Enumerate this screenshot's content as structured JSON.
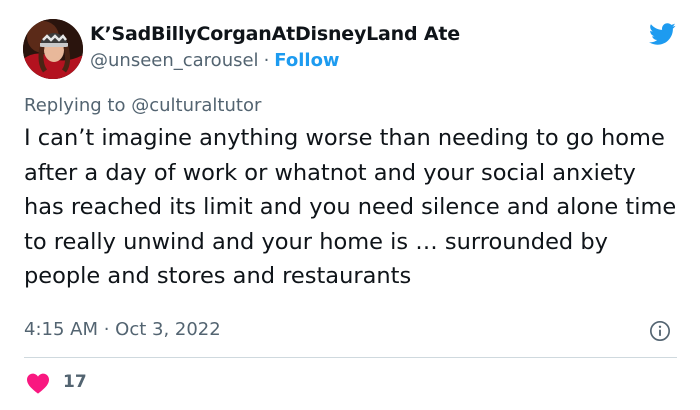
{
  "author": {
    "display_name": "K’SadBillyCorganAtDisneyLand Ate",
    "handle": "@unseen_carousel",
    "separator": "·",
    "follow_label": "Follow"
  },
  "reply": {
    "prefix": "Replying to",
    "mention": "@culturaltutor"
  },
  "tweet": {
    "text": "I can’t imagine anything worse than needing to go home after a day of work or whatnot and your social anxiety has reached its limit and you need silence and alone time to really unwind and your home is … surrounded by people and stores and restaurants",
    "timestamp": "4:15 AM · Oct 3, 2022",
    "like_count": "17"
  },
  "icons": {
    "brand": "twitter-bird-icon",
    "info": "info-icon",
    "like": "heart-icon"
  },
  "colors": {
    "accent": "#1d9bf0",
    "like": "#f91880",
    "text": "#0f1419",
    "muted": "#536471",
    "divider": "#cfd9de"
  }
}
